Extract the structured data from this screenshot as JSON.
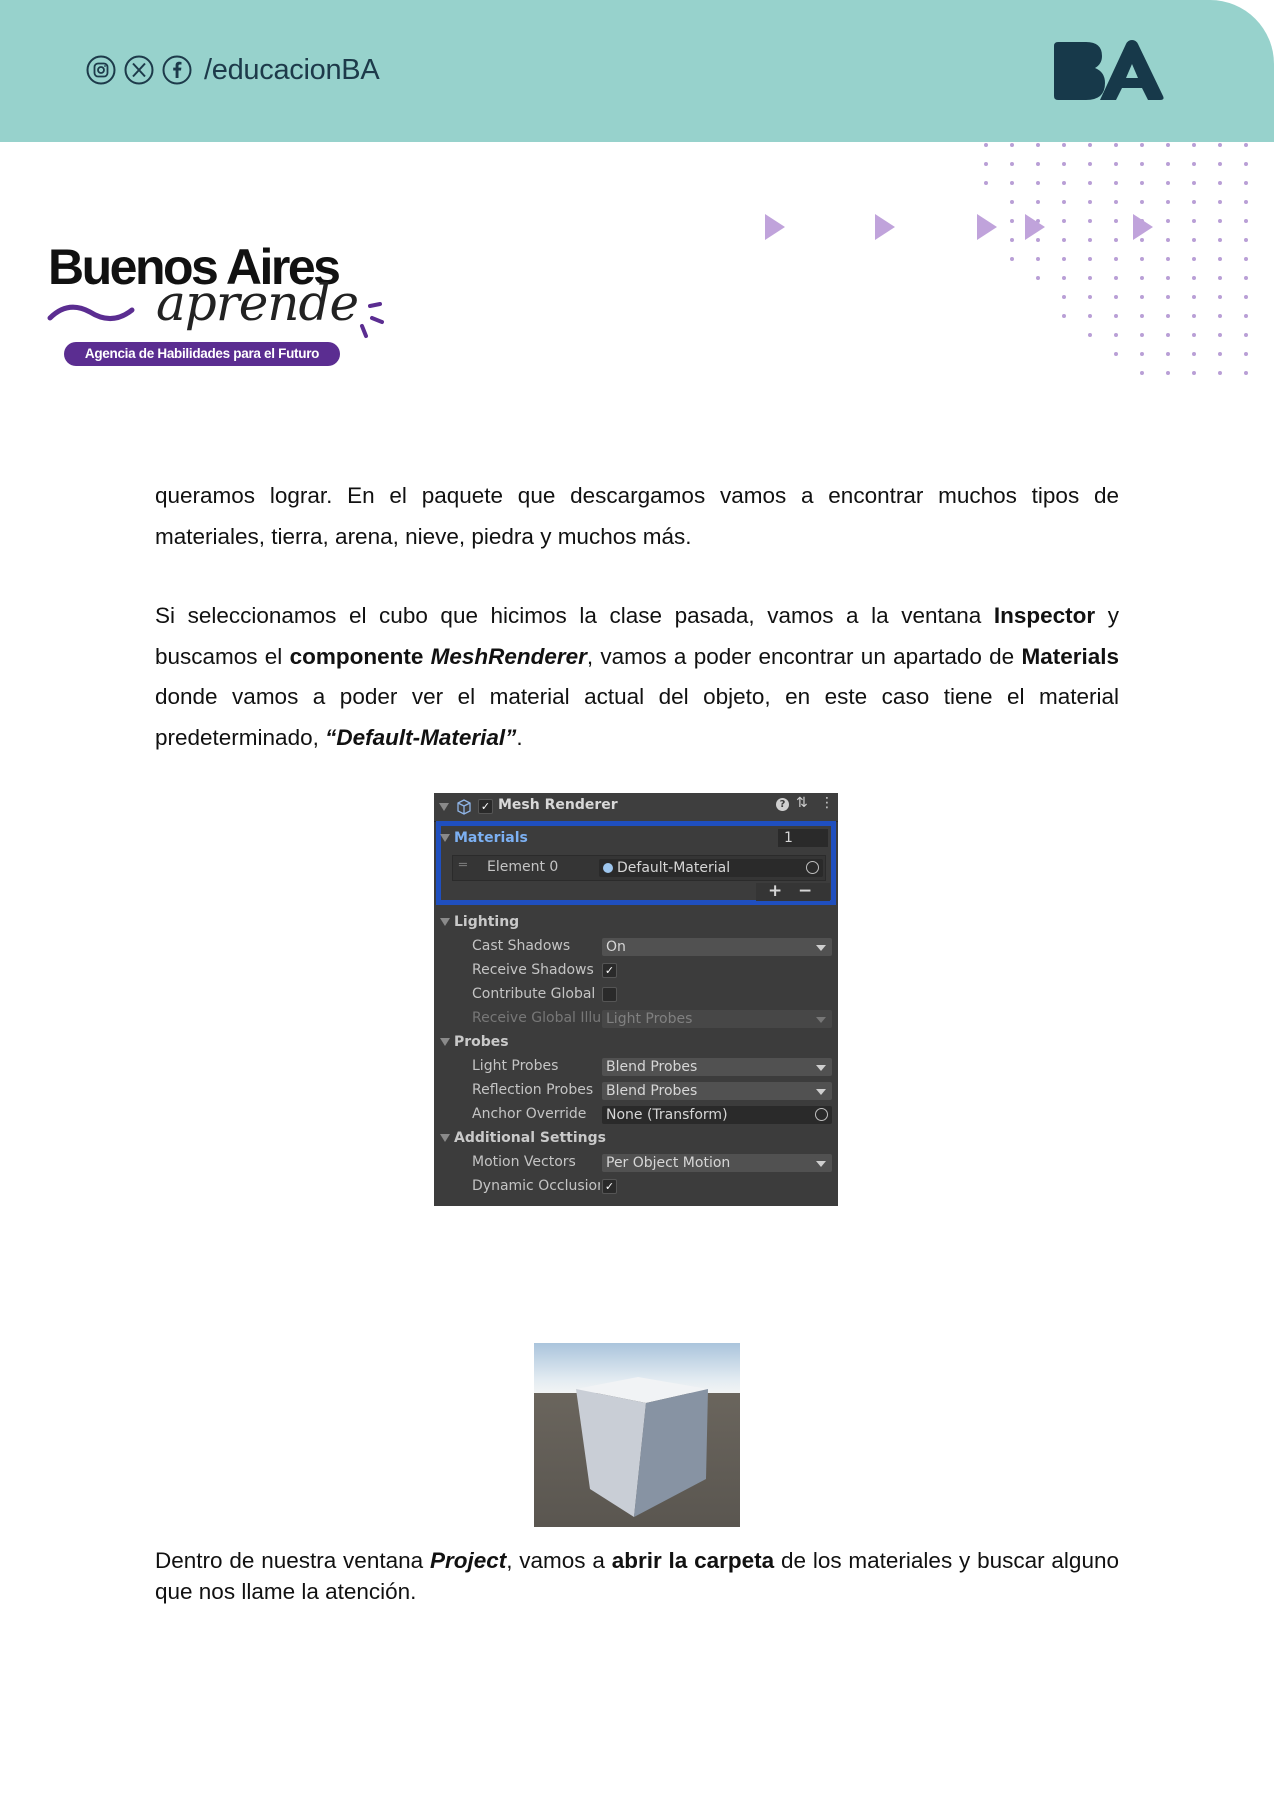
{
  "header": {
    "social_icons": [
      "instagram-icon",
      "x-icon",
      "facebook-icon"
    ],
    "handle": "/educacionBA",
    "logo_text": "BA",
    "band_color": "#97d2cc"
  },
  "brand": {
    "title": "Buenos Aires",
    "subtitle": "aprende",
    "tagline": "Agencia de Habilidades para el Futuro",
    "accent": "#5b2d91"
  },
  "body": {
    "p1": "queramos lograr. En el paquete que descargamos vamos a encontrar muchos tipos de materiales, tierra, arena, nieve, piedra y muchos más.",
    "p2": {
      "t1": "Si seleccionamos el cubo que hicimos la clase pasada, vamos a la ventana ",
      "b1": "Inspector",
      "t2": " y buscamos el ",
      "b2": "componente ",
      "bi1": "MeshRenderer",
      "t3": ", vamos a poder encontrar un apartado de ",
      "b3": "Materials",
      "t4": " donde vamos a poder ver el material actual del objeto, en este caso tiene el material predeterminado, ",
      "bi2": "“Default-Material”",
      "t5": "."
    },
    "p3": {
      "t1": "Dentro de nuestra ventana ",
      "bi1": "Project",
      "t2": ", vamos a ",
      "b1": "abrir la carpeta",
      "t3": " de los materiales y buscar alguno que nos llame la atención."
    }
  },
  "inspector": {
    "component": "Mesh Renderer",
    "materials_label": "Materials",
    "materials_count": "1",
    "element_label": "Element 0",
    "element_value": "Default-Material",
    "plus": "+",
    "minus": "−",
    "lighting": "Lighting",
    "cast_shadows": "Cast Shadows",
    "cast_shadows_value": "On",
    "receive_shadows": "Receive Shadows",
    "contribute_gi": "Contribute Global I",
    "receive_gi": "Receive Global Illu",
    "receive_gi_value": "Light Probes",
    "probes": "Probes",
    "light_probes": "Light Probes",
    "light_probes_value": "Blend Probes",
    "reflection_probes": "Reflection Probes",
    "reflection_probes_value": "Blend Probes",
    "anchor_override": "Anchor Override",
    "anchor_override_value": "None (Transform)",
    "additional": "Additional Settings",
    "motion_vectors": "Motion Vectors",
    "motion_vectors_value": "Per Object Motion",
    "dynamic_occlusion": "Dynamic Occlusion",
    "highlight_color": "#1f4fbf"
  }
}
